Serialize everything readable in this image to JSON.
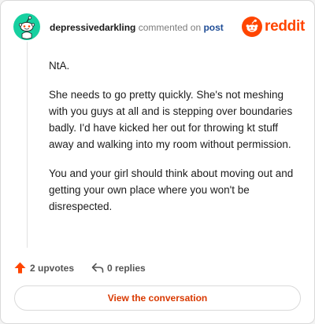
{
  "comment": {
    "username": "depressivedarkling",
    "action_text": "commented on",
    "post_link_text": "post",
    "paragraphs": [
      "NtA.",
      "She needs to go pretty quickly. She's not meshing with you guys at all and is stepping over boundaries badly. I'd have kicked her out for throwing kt stuff away and walking into my room without permission.",
      "You and your girl should think about moving out and getting your own place where you won't be disrespected."
    ]
  },
  "brand": {
    "wordmark": "reddit",
    "color": "#ff4500"
  },
  "actions": {
    "upvotes_label": "2 upvotes",
    "replies_label": "0 replies"
  },
  "cta": {
    "label": "View the conversation"
  },
  "colors": {
    "avatar_bg": "#16d0a0",
    "upvote": "#ff4500",
    "cta_text": "#d93900",
    "post_link": "#1f4d96"
  },
  "icons": {
    "avatar": "snoo-avatar-icon",
    "logo": "reddit-logo-icon",
    "upvote": "upvote-arrow-icon",
    "reply": "reply-arrow-icon"
  }
}
